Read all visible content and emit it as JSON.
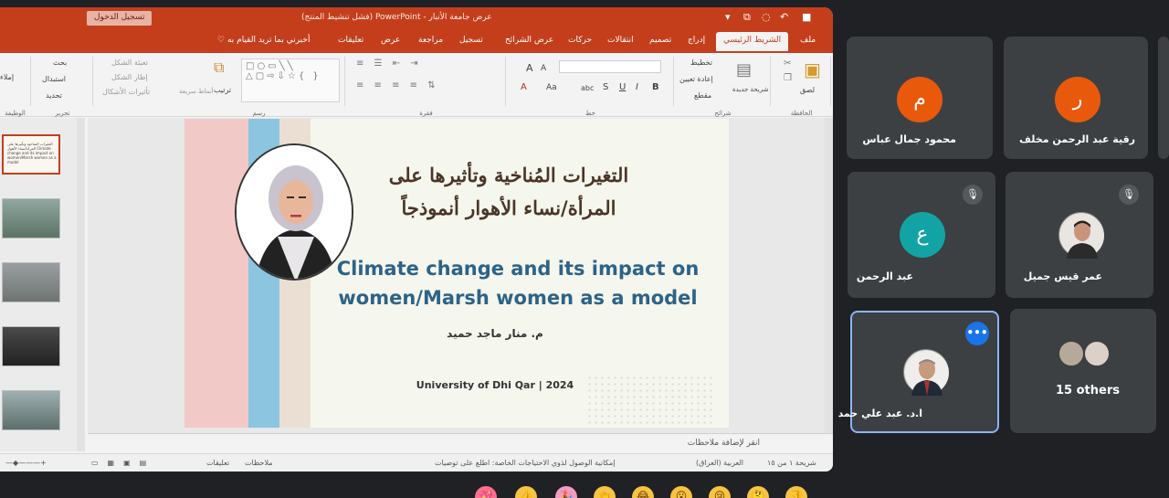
{
  "window": {
    "title": "عرض جامعة الأنبار  -  PowerPoint  (فشل تنشيط المنتج)",
    "sign_in": "تسجيل الدخول",
    "controls": [
      "▾",
      "⧉",
      "◌",
      "↶",
      "■"
    ]
  },
  "ribbon_tabs": [
    {
      "label": "ملف"
    },
    {
      "label": "الشريط الرئيسي",
      "active": true
    },
    {
      "label": "إدراج"
    },
    {
      "label": "تصميم"
    },
    {
      "label": "انتقالات"
    },
    {
      "label": "حركات"
    },
    {
      "label": "عرض الشرائح"
    },
    {
      "label": "تسجيل"
    },
    {
      "label": "مراجعة"
    },
    {
      "label": "عرض"
    },
    {
      "label": "تعليقات"
    }
  ],
  "tell_me": "أخبرني بما تريد القيام به",
  "ribbon": {
    "clipboard": {
      "paste": "لصق",
      "label": "الحافظة"
    },
    "slides": {
      "new": "شريحة جديدة",
      "layout": "تخطيط",
      "reset": "إعادة تعيين",
      "section": "مقطع",
      "label": "شرائح"
    },
    "font": {
      "label": "خط",
      "size_up": "A",
      "size_down": "A",
      "bold": "B",
      "italic": "I",
      "underline": "U",
      "strike": "S",
      "spacing": "abc",
      "case": "Aa"
    },
    "paragraph": {
      "label": "فقرة"
    },
    "drawing": {
      "arrange": "ترتيب",
      "quick_styles": "أنماط سريعة",
      "fill": "تعبئة الشكل",
      "outline": "إطار الشكل",
      "effects": "تأثيرات الأشكال",
      "label": "رسم"
    },
    "editing": {
      "find": "بحث",
      "replace": "استبدال",
      "select": "تحديد",
      "label": "تحرير"
    },
    "voice": {
      "dictate": "إملاء",
      "label": "الوظيفة"
    }
  },
  "slide": {
    "arabic_title_line1": "التغيرات المُناخية وتأثيرها على",
    "arabic_title_line2": "المرأة/نساء الأهوار أنموذجاً",
    "english_title_line1": "Climate change and its impact on",
    "english_title_line2": "women/Marsh women as a model",
    "author": "م. منار ماجد حميد",
    "university": "University of Dhi Qar | 2024",
    "colors": {
      "stripe_pink": "#f1c9c7",
      "stripe_blue": "#8bc5e0",
      "stripe_beige": "#eadfd2",
      "english_title": "#2d6387",
      "arabic_title": "#4a3527"
    }
  },
  "thumbnail_first_text": "التغيرات المناخية وتأثيرها على المرأة/نساء الأهوار Climate change and its impact on women/Marsh women as a model",
  "notes_placeholder": "انقر لإضافة ملاحظات",
  "status": {
    "slide_counter": "شريحة ١ من ١٥",
    "language": "العربية (العراق)",
    "accessibility": "إمكانية الوصول لذوي الاحتياجات الخاصة: اطلع على توصيات",
    "notes": "ملاحظات",
    "comments": "تعليقات"
  },
  "participants": [
    {
      "name": "محمود جمال عباس",
      "initial": "م",
      "color": "#e8590c"
    },
    {
      "name": "رقية عبد الرحمن مخلف",
      "initial": "ر",
      "color": "#e8590c"
    },
    {
      "name": "عبد الرحمن",
      "initial": "ع",
      "color": "#12a4a4",
      "muted": true
    },
    {
      "name": "عمر قيس جميل",
      "muted": true
    },
    {
      "name": "ا.د. عبد علي حمد",
      "speaking": true
    },
    {
      "others_label": "15 others"
    }
  ],
  "icons": {
    "mic_off": "mic-off-icon",
    "more": "more-options-icon"
  },
  "reactions": [
    "💖",
    "👍",
    "🎉",
    "👏",
    "😂",
    "😮",
    "😢",
    "🤔",
    "👎"
  ]
}
